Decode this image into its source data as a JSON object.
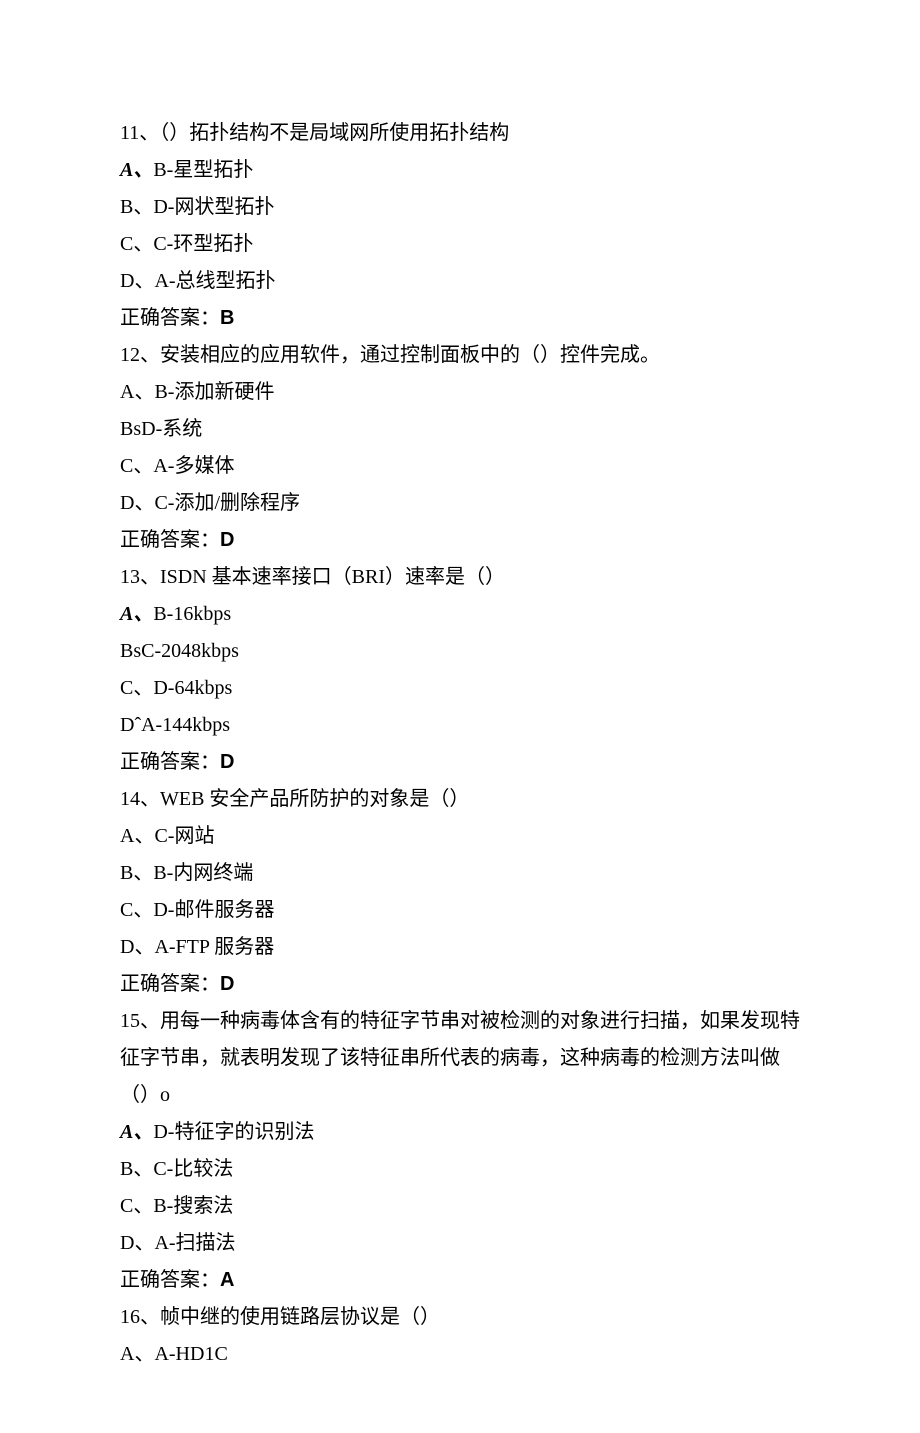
{
  "questions": [
    {
      "number": "11、",
      "stem": "（）拓扑结构不是局域网所使用拓扑结构",
      "options": [
        {
          "prefix": "A、",
          "prefixStyle": "italic",
          "text": "B-星型拓扑"
        },
        {
          "prefix": "B、",
          "prefixStyle": "",
          "text": "D-网状型拓扑"
        },
        {
          "prefix": "C、",
          "prefixStyle": "",
          "text": "C-环型拓扑"
        },
        {
          "prefix": "D、",
          "prefixStyle": "",
          "text": "A-总线型拓扑"
        }
      ],
      "answerLabel": "正确答案：",
      "answer": "B"
    },
    {
      "number": "12、",
      "stem": "安装相应的应用软件，通过控制面板中的（）控件完成。",
      "options": [
        {
          "prefix": "A、",
          "prefixStyle": "",
          "text": "B-添加新硬件"
        },
        {
          "prefix": "BsD-",
          "prefixStyle": "",
          "text": "系统"
        },
        {
          "prefix": "C、",
          "prefixStyle": "",
          "text": "A-多媒体"
        },
        {
          "prefix": "D、",
          "prefixStyle": "",
          "text": "C-添加/删除程序"
        }
      ],
      "answerLabel": "正确答案：",
      "answer": "D"
    },
    {
      "number": "13、",
      "stem": "ISDN 基本速率接口（BRI）速率是（）",
      "options": [
        {
          "prefix": "A、",
          "prefixStyle": "italic",
          "text": "B-16kbps"
        },
        {
          "prefix": "BsC-",
          "prefixStyle": "",
          "text": "2048kbps"
        },
        {
          "prefix": "C、",
          "prefixStyle": "",
          "text": "D-64kbps"
        },
        {
          "prefix": "DˆA-",
          "prefixStyle": "",
          "text": "144kbps"
        }
      ],
      "answerLabel": "正确答案：",
      "answer": "D"
    },
    {
      "number": "14、",
      "stem": "WEB 安全产品所防护的对象是（）",
      "options": [
        {
          "prefix": "A、",
          "prefixStyle": "",
          "text": "C-网站"
        },
        {
          "prefix": "B、",
          "prefixStyle": "",
          "text": "B-内网终端"
        },
        {
          "prefix": "C、",
          "prefixStyle": "",
          "text": "D-邮件服务器"
        },
        {
          "prefix": "D、",
          "prefixStyle": "",
          "text": "A-FTP 服务器"
        }
      ],
      "answerLabel": "正确答案：",
      "answer": "D"
    },
    {
      "number": "15、",
      "stem": "用每一种病毒体含有的特征字节串对被检测的对象进行扫描，如果发现特征字节串，就表明发现了该特征串所代表的病毒，这种病毒的检测方法叫做（）o",
      "options": [
        {
          "prefix": "A、",
          "prefixStyle": "italic",
          "text": "D-特征字的识别法"
        },
        {
          "prefix": "B、",
          "prefixStyle": "",
          "text": "C-比较法"
        },
        {
          "prefix": "C、",
          "prefixStyle": "",
          "text": "B-搜索法"
        },
        {
          "prefix": "D、",
          "prefixStyle": "",
          "text": "A-扫描法"
        }
      ],
      "answerLabel": "正确答案：",
      "answer": "A"
    },
    {
      "number": "16、",
      "stem": "帧中继的使用链路层协议是（）",
      "options": [
        {
          "prefix": "A、",
          "prefixStyle": "",
          "text": "A-HD1C"
        }
      ],
      "answerLabel": "",
      "answer": ""
    }
  ]
}
